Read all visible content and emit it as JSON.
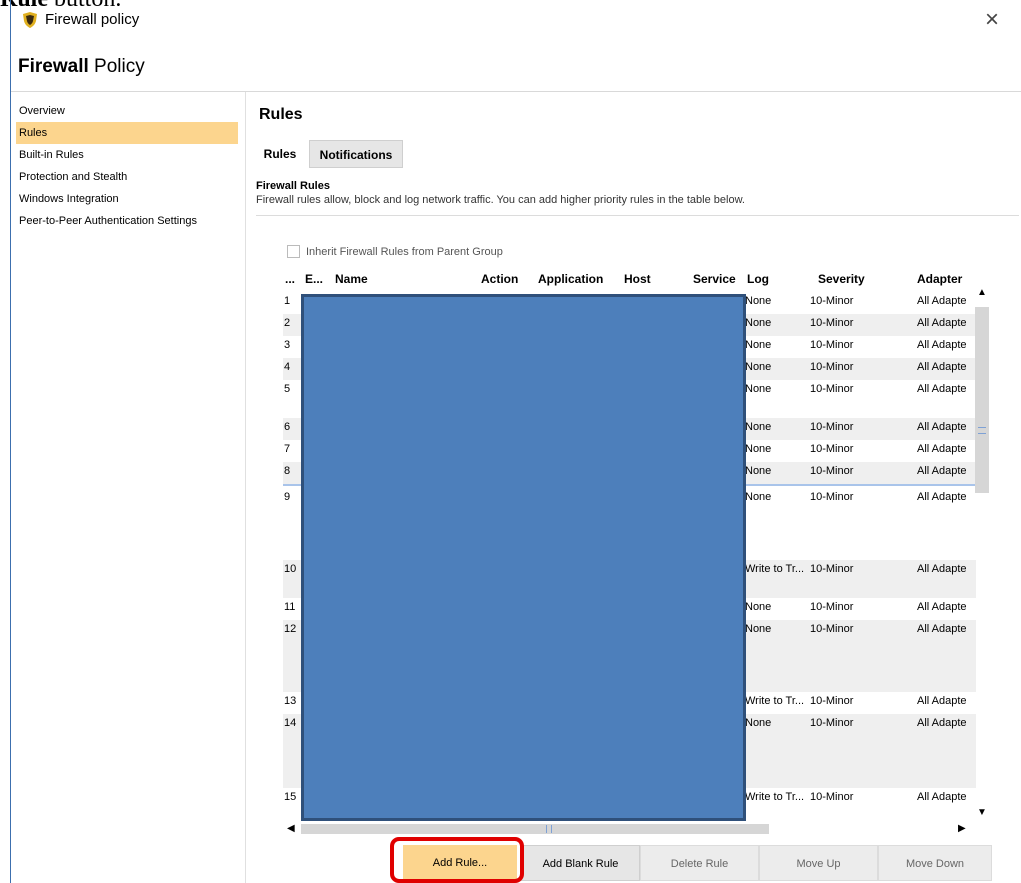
{
  "doc_fragment": {
    "bold": "Rule",
    "rest": " button."
  },
  "window": {
    "title": "Firewall policy",
    "close": "×"
  },
  "header": {
    "bold": "Firewall",
    "rest": " Policy"
  },
  "sidebar": {
    "items": [
      {
        "label": "Overview"
      },
      {
        "label": "Rules"
      },
      {
        "label": "Built-in Rules"
      },
      {
        "label": "Protection and Stealth"
      },
      {
        "label": "Windows Integration"
      },
      {
        "label": "Peer-to-Peer Authentication Settings"
      }
    ]
  },
  "main": {
    "title": "Rules",
    "tabs": [
      {
        "label": "Rules"
      },
      {
        "label": "Notifications"
      }
    ],
    "section_heading": "Firewall Rules",
    "section_desc": "Firewall rules allow, block and log network traffic. You can add higher priority rules in the table below.",
    "inherit_label": "Inherit Firewall Rules from Parent Group",
    "inherit_checked": false
  },
  "table": {
    "columns": [
      "...",
      "E...",
      "Name",
      "Action",
      "Application",
      "Host",
      "Service",
      "Log",
      "Severity",
      "Adapter"
    ],
    "rows": [
      {
        "num": "1",
        "log": "None",
        "severity": "10-Minor",
        "adapter": "All Adapte"
      },
      {
        "num": "2",
        "log": "None",
        "severity": "10-Minor",
        "adapter": "All Adapte"
      },
      {
        "num": "3",
        "log": "None",
        "severity": "10-Minor",
        "adapter": "All Adapte"
      },
      {
        "num": "4",
        "log": "None",
        "severity": "10-Minor",
        "adapter": "All Adapte"
      },
      {
        "num": "5",
        "log": "None",
        "severity": "10-Minor",
        "adapter": "All Adapte"
      },
      {
        "num": "6",
        "log": "None",
        "severity": "10-Minor",
        "adapter": "All Adapte"
      },
      {
        "num": "7",
        "log": "None",
        "severity": "10-Minor",
        "adapter": "All Adapte"
      },
      {
        "num": "8",
        "log": "None",
        "severity": "10-Minor",
        "adapter": "All Adapte"
      },
      {
        "num": "9",
        "log": "None",
        "severity": "10-Minor",
        "adapter": "All Adapte"
      },
      {
        "num": "10",
        "log": "Write to Tr...",
        "severity": "10-Minor",
        "adapter": "All Adapte"
      },
      {
        "num": "11",
        "log": "None",
        "severity": "10-Minor",
        "adapter": "All Adapte"
      },
      {
        "num": "12",
        "log": "None",
        "severity": "10-Minor",
        "adapter": "All Adapte"
      },
      {
        "num": "13",
        "log": "Write to Tr...",
        "severity": "10-Minor",
        "adapter": "All Adapte"
      },
      {
        "num": "14",
        "log": "None",
        "severity": "10-Minor",
        "adapter": "All Adapte"
      },
      {
        "num": "15",
        "log": "Write to Tr...",
        "severity": "10-Minor",
        "adapter": "All Adapte"
      }
    ]
  },
  "buttons": {
    "add_rule": "Add Rule...",
    "add_blank_rule": "Add Blank Rule",
    "delete_rule": "Delete Rule",
    "move_up": "Move Up",
    "move_down": "Move Down"
  },
  "colors": {
    "accent": "#fcd58e",
    "redaction": "#4d7fbb",
    "highlight": "#e00000"
  }
}
